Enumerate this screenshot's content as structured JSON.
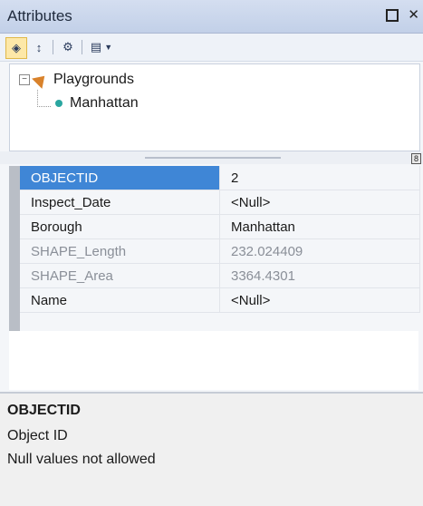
{
  "window": {
    "title": "Attributes"
  },
  "toolbar": {
    "buttons": [
      "show-layers",
      "sort",
      "options",
      "view"
    ]
  },
  "tree": {
    "layer": "Playgrounds",
    "feature": "Manhattan"
  },
  "grid": {
    "rows": [
      {
        "key": "OBJECTID",
        "value": "2",
        "selected": true,
        "readonly": false
      },
      {
        "key": "Inspect_Date",
        "value": "<Null>",
        "selected": false,
        "readonly": false
      },
      {
        "key": "Borough",
        "value": "Manhattan",
        "selected": false,
        "readonly": false
      },
      {
        "key": "SHAPE_Length",
        "value": "232.024409",
        "selected": false,
        "readonly": true
      },
      {
        "key": "SHAPE_Area",
        "value": "3364.4301",
        "selected": false,
        "readonly": true
      },
      {
        "key": "Name",
        "value": "<Null>",
        "selected": false,
        "readonly": false
      }
    ]
  },
  "description": {
    "title": "OBJECTID",
    "line1": "Object ID",
    "line2": "Null values not allowed"
  }
}
